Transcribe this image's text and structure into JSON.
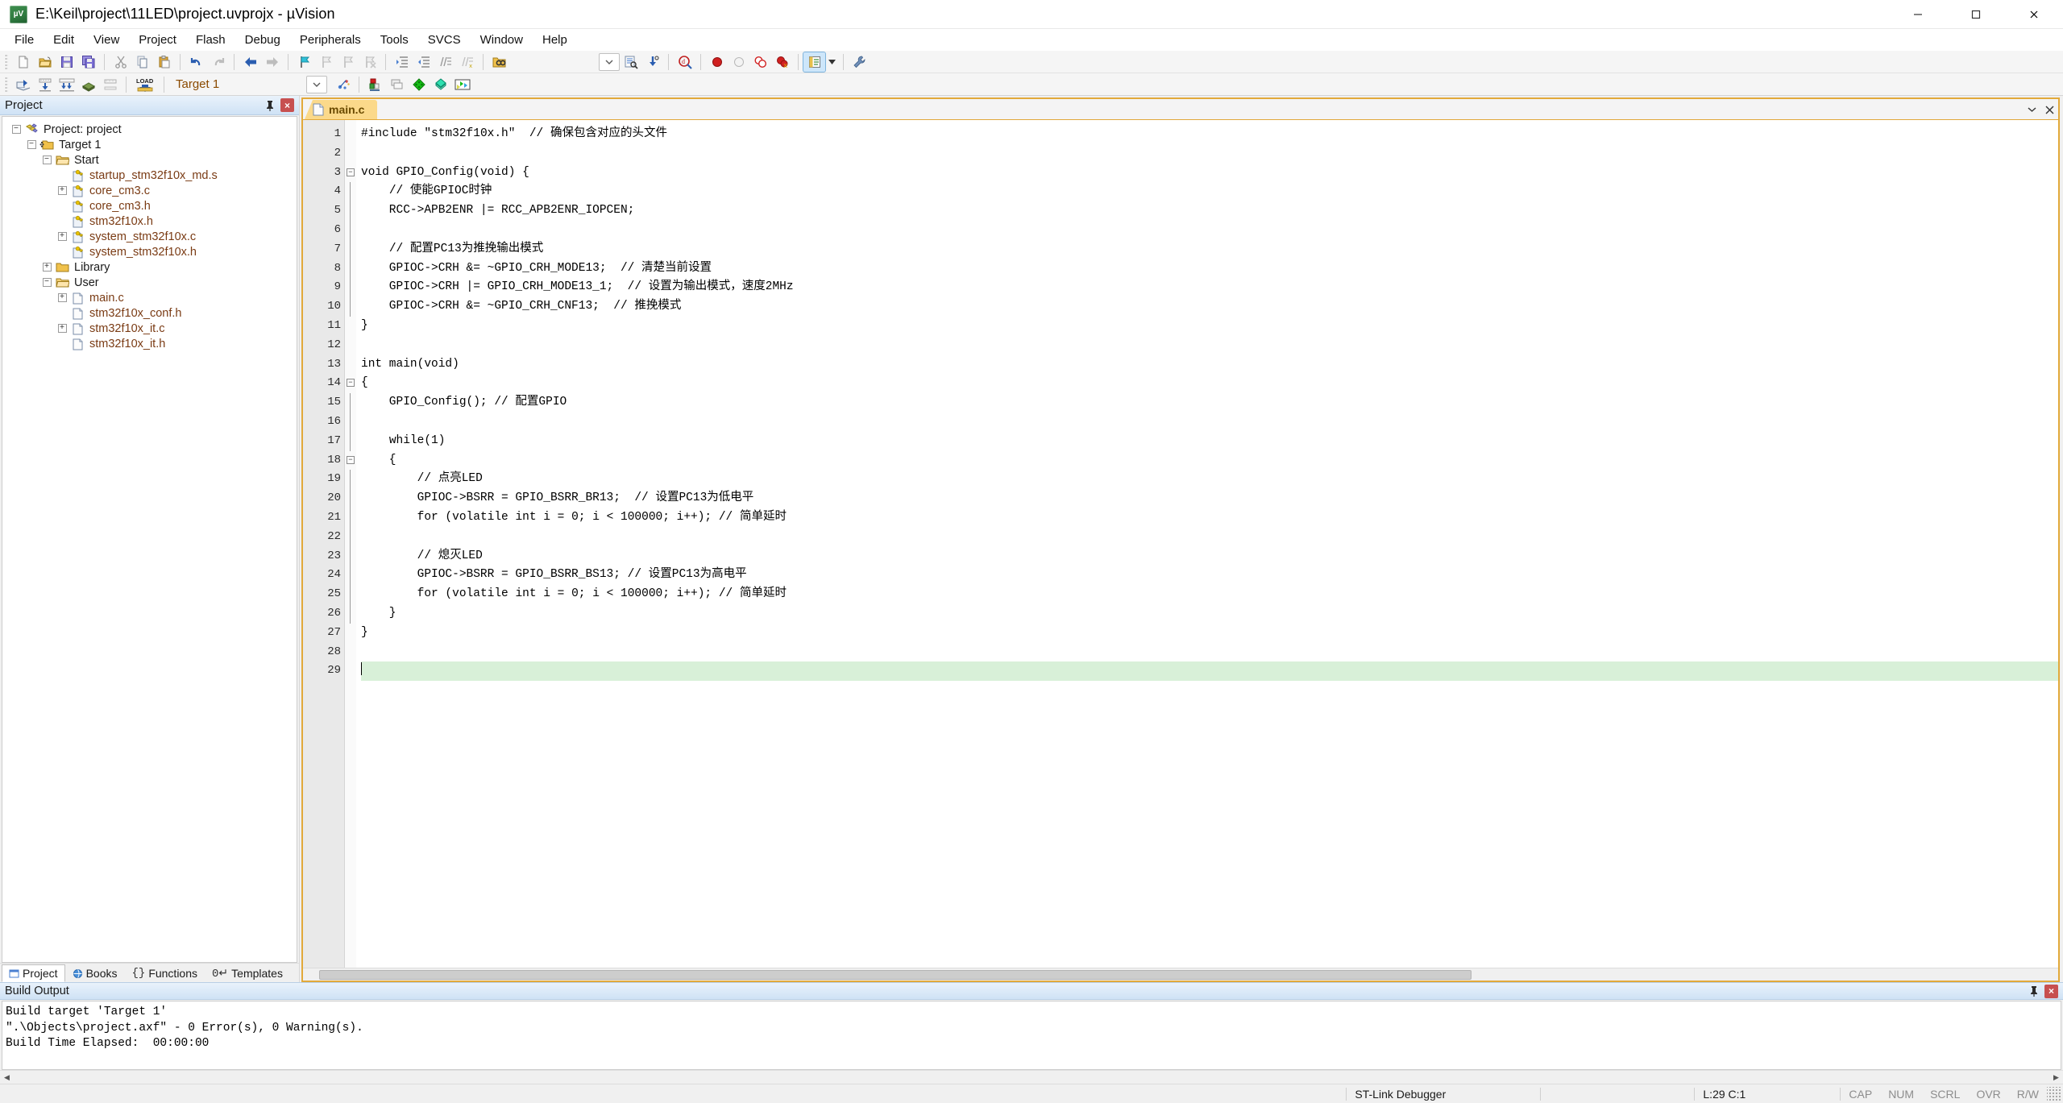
{
  "window": {
    "title": "E:\\Keil\\project\\11LED\\project.uvprojx - µVision",
    "app_icon": "keil-uvision-icon",
    "minimize_label": "Minimize",
    "maximize_label": "Maximize",
    "close_label": "Close"
  },
  "menubar": {
    "items": [
      {
        "label": "File"
      },
      {
        "label": "Edit"
      },
      {
        "label": "View"
      },
      {
        "label": "Project"
      },
      {
        "label": "Flash"
      },
      {
        "label": "Debug"
      },
      {
        "label": "Peripherals"
      },
      {
        "label": "Tools"
      },
      {
        "label": "SVCS"
      },
      {
        "label": "Window"
      },
      {
        "label": "Help"
      }
    ]
  },
  "toolbar_main": {
    "buttons": [
      {
        "name": "new-file-icon",
        "tip": "New"
      },
      {
        "name": "open-file-icon",
        "tip": "Open"
      },
      {
        "name": "save-icon",
        "tip": "Save"
      },
      {
        "name": "save-all-icon",
        "tip": "Save All"
      },
      {
        "name": "cut-icon",
        "tip": "Cut"
      },
      {
        "name": "copy-icon",
        "tip": "Copy"
      },
      {
        "name": "paste-icon",
        "tip": "Paste"
      },
      {
        "name": "undo-icon",
        "tip": "Undo"
      },
      {
        "name": "redo-icon",
        "tip": "Redo"
      },
      {
        "name": "navigate-back-icon",
        "tip": "Back"
      },
      {
        "name": "navigate-forward-icon",
        "tip": "Forward"
      },
      {
        "name": "toggle-bookmark-icon",
        "tip": "Toggle Bookmark"
      },
      {
        "name": "prev-bookmark-icon",
        "tip": "Previous Bookmark"
      },
      {
        "name": "next-bookmark-icon",
        "tip": "Next Bookmark"
      },
      {
        "name": "clear-bookmarks-icon",
        "tip": "Clear All Bookmarks"
      },
      {
        "name": "indent-icon",
        "tip": "Indent Selected Text"
      },
      {
        "name": "outdent-icon",
        "tip": "Unindent Selected Text"
      },
      {
        "name": "comment-icon",
        "tip": "Comment Selection"
      },
      {
        "name": "uncomment-icon",
        "tip": "Uncomment Selection"
      },
      {
        "name": "find-in-files-icon",
        "tip": "Find in Files"
      },
      {
        "name": "search-dropdown-icon",
        "tip": "Search List"
      },
      {
        "name": "incremental-find-icon",
        "tip": "Incremental Find"
      },
      {
        "name": "goto-definition-icon",
        "tip": "Go To Definition"
      },
      {
        "name": "debug-find-icon",
        "tip": "Find"
      },
      {
        "name": "insert-breakpoint-icon",
        "tip": "Insert/Remove Breakpoint"
      },
      {
        "name": "enable-breakpoint-icon",
        "tip": "Enable/Disable Breakpoint"
      },
      {
        "name": "disable-all-breakpoints-icon",
        "tip": "Disable All Breakpoints"
      },
      {
        "name": "kill-all-breakpoints-icon",
        "tip": "Kill All Breakpoints"
      },
      {
        "name": "configuration-wizard-icon",
        "tip": "Configuration Wizard"
      },
      {
        "name": "configure-toolbar-icon",
        "tip": "Customize Tools"
      }
    ]
  },
  "toolbar_build": {
    "buttons": [
      {
        "name": "translate-file-icon",
        "tip": "Translate Current File"
      },
      {
        "name": "build-target-icon",
        "tip": "Build Target"
      },
      {
        "name": "rebuild-all-icon",
        "tip": "Rebuild All Target Files"
      },
      {
        "name": "batch-build-icon",
        "tip": "Batch Build"
      },
      {
        "name": "stop-build-icon",
        "tip": "Stop Build"
      },
      {
        "name": "download-icon",
        "tip": "Download"
      }
    ],
    "target_value": "Target 1",
    "after_buttons": [
      {
        "name": "target-options-icon",
        "tip": "Options for Target"
      },
      {
        "name": "manage-project-items-icon",
        "tip": "Manage Project Items"
      },
      {
        "name": "pack-installer-icon",
        "tip": "Pack Installer"
      },
      {
        "name": "manage-run-time-env-icon",
        "tip": "Manage Run-Time Environment"
      },
      {
        "name": "select-software-packs-icon",
        "tip": "Select Software Packs"
      }
    ]
  },
  "project_panel": {
    "title": "Project",
    "pin_icon": "pin-icon",
    "close_icon": "close-icon",
    "tree": [
      {
        "indent": 0,
        "expander": "-",
        "icon": "project-icon",
        "label": "Project: project",
        "style": "dark"
      },
      {
        "indent": 1,
        "expander": "-",
        "icon": "target-icon",
        "label": "Target 1",
        "style": "dark"
      },
      {
        "indent": 2,
        "expander": "-",
        "icon": "folder-open-icon",
        "label": "Start",
        "style": "dark"
      },
      {
        "indent": 3,
        "expander": "",
        "icon": "source-key-icon",
        "label": "startup_stm32f10x_md.s",
        "style": "src"
      },
      {
        "indent": 3,
        "expander": "+",
        "icon": "source-key-icon",
        "label": "core_cm3.c",
        "style": "src"
      },
      {
        "indent": 3,
        "expander": "",
        "icon": "source-key-icon",
        "label": "core_cm3.h",
        "style": "src"
      },
      {
        "indent": 3,
        "expander": "",
        "icon": "source-key-icon",
        "label": "stm32f10x.h",
        "style": "src"
      },
      {
        "indent": 3,
        "expander": "+",
        "icon": "source-key-icon",
        "label": "system_stm32f10x.c",
        "style": "src"
      },
      {
        "indent": 3,
        "expander": "",
        "icon": "source-key-icon",
        "label": "system_stm32f10x.h",
        "style": "src"
      },
      {
        "indent": 2,
        "expander": "+",
        "icon": "folder-closed-icon",
        "label": "Library",
        "style": "dark"
      },
      {
        "indent": 2,
        "expander": "-",
        "icon": "folder-open-icon",
        "label": "User",
        "style": "dark"
      },
      {
        "indent": 3,
        "expander": "+",
        "icon": "source-file-icon",
        "label": "main.c",
        "style": "src"
      },
      {
        "indent": 3,
        "expander": "",
        "icon": "source-file-icon",
        "label": "stm32f10x_conf.h",
        "style": "src"
      },
      {
        "indent": 3,
        "expander": "+",
        "icon": "source-file-icon",
        "label": "stm32f10x_it.c",
        "style": "src"
      },
      {
        "indent": 3,
        "expander": "",
        "icon": "source-file-icon",
        "label": "stm32f10x_it.h",
        "style": "src"
      }
    ],
    "tabs": [
      {
        "label": "Project",
        "icon": "project-tab-icon",
        "selected": true
      },
      {
        "label": "Books",
        "icon": "books-tab-icon",
        "selected": false
      },
      {
        "label": "Functions",
        "icon": "functions-tab-icon",
        "selected": false
      },
      {
        "label": "Templates",
        "icon": "templates-tab-icon",
        "selected": false
      }
    ]
  },
  "editor": {
    "tabs": [
      {
        "label": "main.c",
        "icon": "c-file-icon",
        "active": true
      }
    ],
    "window_restore_icon": "chevron-down-icon",
    "window_close_icon": "close-icon",
    "current_line": 29,
    "lines": [
      {
        "n": 1,
        "fold": "",
        "text": "#include \"stm32f10x.h\"  // 确保包含对应的头文件"
      },
      {
        "n": 2,
        "fold": "",
        "text": ""
      },
      {
        "n": 3,
        "fold": "-",
        "text": "void GPIO_Config(void) {"
      },
      {
        "n": 4,
        "fold": "|",
        "text": "    // 使能GPIOC时钟"
      },
      {
        "n": 5,
        "fold": "|",
        "text": "    RCC->APB2ENR |= RCC_APB2ENR_IOPCEN;"
      },
      {
        "n": 6,
        "fold": "|",
        "text": ""
      },
      {
        "n": 7,
        "fold": "|",
        "text": "    // 配置PC13为推挽输出模式"
      },
      {
        "n": 8,
        "fold": "|",
        "text": "    GPIOC->CRH &= ~GPIO_CRH_MODE13;  // 清楚当前设置"
      },
      {
        "n": 9,
        "fold": "|",
        "text": "    GPIOC->CRH |= GPIO_CRH_MODE13_1;  // 设置为输出模式，速度2MHz"
      },
      {
        "n": 10,
        "fold": "|",
        "text": "    GPIOC->CRH &= ~GPIO_CRH_CNF13;  // 推挽模式"
      },
      {
        "n": 11,
        "fold": "",
        "text": "}"
      },
      {
        "n": 12,
        "fold": "",
        "text": ""
      },
      {
        "n": 13,
        "fold": "",
        "text": "int main(void)"
      },
      {
        "n": 14,
        "fold": "-",
        "text": "{"
      },
      {
        "n": 15,
        "fold": "|",
        "text": "    GPIO_Config(); // 配置GPIO"
      },
      {
        "n": 16,
        "fold": "|",
        "text": ""
      },
      {
        "n": 17,
        "fold": "|",
        "text": "    while(1)"
      },
      {
        "n": 18,
        "fold": "-",
        "text": "    {"
      },
      {
        "n": 19,
        "fold": "|",
        "text": "        // 点亮LED"
      },
      {
        "n": 20,
        "fold": "|",
        "text": "        GPIOC->BSRR = GPIO_BSRR_BR13;  // 设置PC13为低电平"
      },
      {
        "n": 21,
        "fold": "|",
        "text": "        for (volatile int i = 0; i < 100000; i++); // 简单延时"
      },
      {
        "n": 22,
        "fold": "|",
        "text": ""
      },
      {
        "n": 23,
        "fold": "|",
        "text": "        // 熄灭LED"
      },
      {
        "n": 24,
        "fold": "|",
        "text": "        GPIOC->BSRR = GPIO_BSRR_BS13; // 设置PC13为高电平"
      },
      {
        "n": 25,
        "fold": "|",
        "text": "        for (volatile int i = 0; i < 100000; i++); // 简单延时"
      },
      {
        "n": 26,
        "fold": "|",
        "text": "    }"
      },
      {
        "n": 27,
        "fold": "",
        "text": "}"
      },
      {
        "n": 28,
        "fold": "",
        "text": ""
      },
      {
        "n": 29,
        "fold": "",
        "text": ""
      }
    ]
  },
  "build_output": {
    "title": "Build Output",
    "pin_icon": "pin-icon",
    "close_icon": "close-icon",
    "lines": [
      "Build target 'Target 1'",
      "\".\\Objects\\project.axf\" - 0 Error(s), 0 Warning(s).",
      "Build Time Elapsed:  00:00:00"
    ]
  },
  "statusbar": {
    "debugger": "ST-Link Debugger",
    "position": "L:29 C:1",
    "indicators": [
      "CAP",
      "NUM",
      "SCRL",
      "OVR",
      "R/W"
    ]
  },
  "colors": {
    "accent_orange": "#e2a93a",
    "tab_active": "#fbd98a",
    "tree_text": "#7a3b14",
    "comment": "#1e8a1e",
    "keyword": "#0000d0",
    "string": "#c000c0",
    "preprocessor": "#8a8a00",
    "current_line": "#d8f0d8",
    "panel_header": "#cfe2f5"
  }
}
